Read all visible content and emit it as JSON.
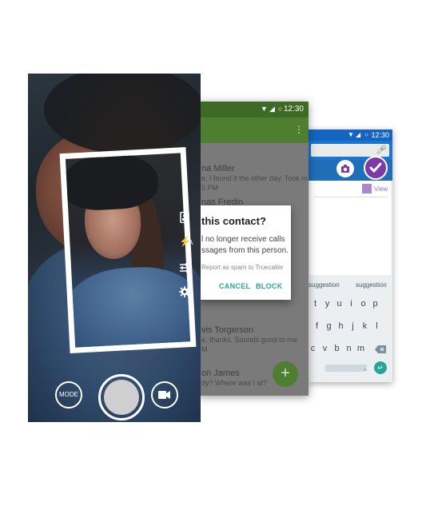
{
  "back_panel": {
    "status_time": "12:30",
    "suggestions": [
      "suggestion",
      "suggestion"
    ],
    "onenote_view_label": "View",
    "keyboard_rows": [
      [
        "t",
        "y",
        "u",
        "i",
        "o",
        "p"
      ],
      [
        "f",
        "g",
        "h",
        "j",
        "k",
        "l"
      ],
      [
        "c",
        "v",
        "b",
        "n",
        "m"
      ]
    ],
    "keys_extra": {
      "period": ".",
      "enter_icon": "enter-icon",
      "backspace_icon": "backspace-icon"
    },
    "icons": {
      "camera": "camera-icon",
      "check": "check-icon",
      "mic": "mic-icon"
    },
    "colors": {
      "status": "#1565c0",
      "accent": "#7b3aa8",
      "enter": "#26a69a"
    }
  },
  "middle_panel": {
    "status_time": "12:30",
    "messages": [
      {
        "name": "na Miller",
        "text": "e, I found it the other day. Took m",
        "time": "5 PM"
      },
      {
        "name": "nas Fredin",
        "text": "",
        "time": ""
      },
      {
        "name": "vis Torgerson",
        "text": "e, thanks. Sounds good to me.",
        "time": "M"
      },
      {
        "name": "on James",
        "text": "dy? Where was I at?",
        "time": ""
      }
    ],
    "dialog": {
      "title": "this contact?",
      "body_line1": "l no longer receive calls",
      "body_line2": "ssages from this person.",
      "checkbox_label": "Report as spam to Truecaller",
      "cancel_label": "CANCEL",
      "block_label": "BLOCK"
    },
    "fab_symbol": "+",
    "colors": {
      "status": "#3d6a25",
      "toolbar": "#4e7f31",
      "action": "#26a69a"
    }
  },
  "front_panel": {
    "mode_label": "MODE",
    "side_icons": [
      "portrait-icon",
      "flash-auto-icon",
      "sliders-icon",
      "settings-icon"
    ],
    "flash_auto_letter": "A",
    "icons": {
      "video": "video-camera-icon"
    }
  }
}
